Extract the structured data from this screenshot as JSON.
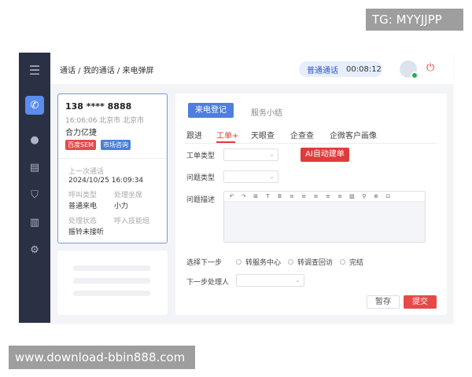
{
  "watermarks": {
    "top": "TG: MYYJJPP",
    "bottom": "www.download-bbin888.com"
  },
  "sidebar": {
    "items": [
      {
        "icon": "menu-icon",
        "glyph": "☰"
      },
      {
        "icon": "phone-icon",
        "glyph": "✆",
        "active": true
      },
      {
        "icon": "user-icon",
        "glyph": "●"
      },
      {
        "icon": "clipboard-icon",
        "glyph": "▤"
      },
      {
        "icon": "shield-icon",
        "glyph": "⛉"
      },
      {
        "icon": "bar-chart-icon",
        "glyph": "▥"
      },
      {
        "icon": "gear-icon",
        "glyph": "⚙"
      }
    ]
  },
  "header": {
    "breadcrumb": "通话 / 我的通话 / 来电弹屏",
    "call_type": "普通通话",
    "call_timer": "00:08:12"
  },
  "caller": {
    "phone": "138 **** 8888",
    "time_location": "16:06:06  北京市 北京市",
    "company": "合力亿捷",
    "tags": [
      "百度SEM",
      "市场咨询"
    ],
    "last_call_label": "上一次通话",
    "last_call_value": "2024/10/25  16:09:34",
    "call_type_label": "呼叫类型",
    "call_type_value": "普通来电",
    "agent_label": "处理坐席",
    "agent_value": "小力",
    "status_label": "处理状态",
    "status_value": "振铃未接听",
    "skill_group_label": "呼入技能组"
  },
  "main": {
    "tabs_top": [
      "来电登记",
      "服务小结"
    ],
    "subtabs": [
      "跟进",
      "工单+",
      "天眼查",
      "企查查",
      "企微客户画像"
    ],
    "fields": {
      "ticket_type": "工单类型",
      "issue_type": "问题类型",
      "issue_desc": "问题描述",
      "next_step": "选择下一步",
      "next_handler": "下一步处理人"
    },
    "ai_button": "AI自动建单",
    "editor_toolbar": [
      "↶",
      "↷",
      "⊞",
      "T",
      "B",
      "≡",
      "≡",
      "≡",
      "≡",
      "≡",
      "▨",
      "⚲",
      "⊕",
      "⊡"
    ],
    "next_step_options": [
      "转服务中心",
      "转调查回访",
      "完结"
    ],
    "draft_button": "暂存",
    "submit_button": "提交"
  },
  "colors": {
    "sidebar": "#2b3145",
    "accent_blue": "#4f7ee0",
    "accent_red": "#e03b3b"
  }
}
